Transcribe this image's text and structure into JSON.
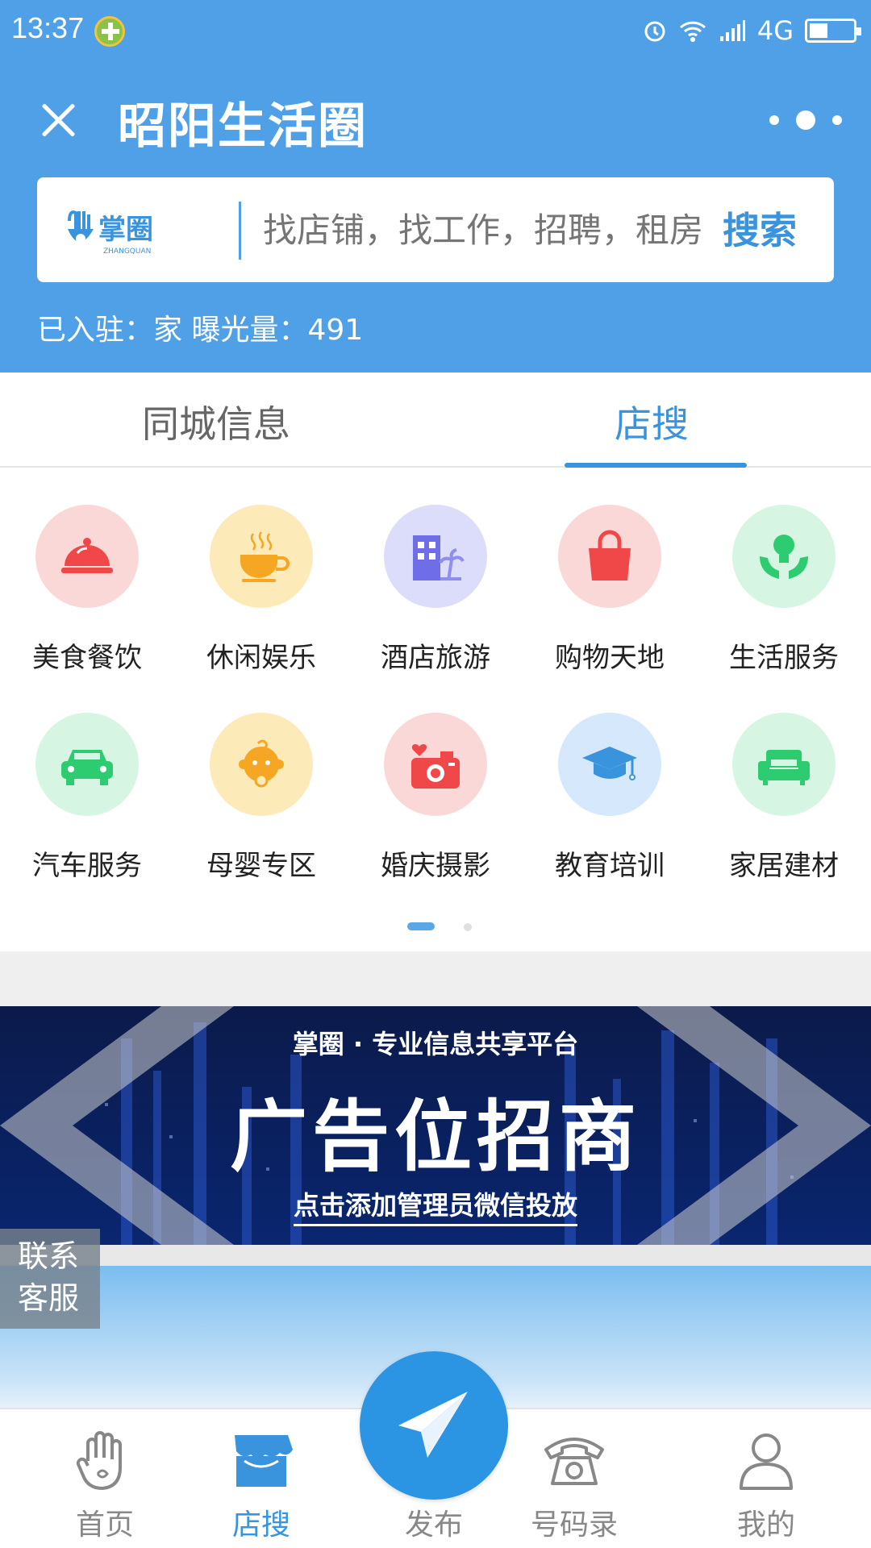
{
  "status_bar": {
    "time": "13:37",
    "network": "4G"
  },
  "header": {
    "title": "昭阳生活圈"
  },
  "search": {
    "brand": "掌圈",
    "brand_sub": "ZHANGQUAN",
    "placeholder": "找店铺，找工作，招聘，租房",
    "button_label": "搜索"
  },
  "stats": {
    "text": "已入驻：家 曝光量：491"
  },
  "tabs": [
    {
      "label": "同城信息",
      "active": false
    },
    {
      "label": "店搜",
      "active": true
    }
  ],
  "categories": [
    {
      "label": "美食餐饮",
      "icon": "food-cloche-icon",
      "bg": "#fbd8d8",
      "color": "#f04848"
    },
    {
      "label": "休闲娱乐",
      "icon": "coffee-cup-icon",
      "bg": "#fdeab9",
      "color": "#f5a623"
    },
    {
      "label": "酒店旅游",
      "icon": "hotel-building-icon",
      "bg": "#dcdcfb",
      "color": "#6f6ee8"
    },
    {
      "label": "购物天地",
      "icon": "shopping-bag-icon",
      "bg": "#fbd8d8",
      "color": "#f04848"
    },
    {
      "label": "生活服务",
      "icon": "lightbulb-hands-icon",
      "bg": "#d6f5e3",
      "color": "#2ecc71"
    },
    {
      "label": "汽车服务",
      "icon": "car-icon",
      "bg": "#d6f5e3",
      "color": "#2ecc71"
    },
    {
      "label": "母婴专区",
      "icon": "baby-icon",
      "bg": "#fdeab9",
      "color": "#f5a623"
    },
    {
      "label": "婚庆摄影",
      "icon": "camera-heart-icon",
      "bg": "#fbd8d8",
      "color": "#f04848"
    },
    {
      "label": "教育培训",
      "icon": "graduation-cap-icon",
      "bg": "#d6e8fb",
      "color": "#3a93dd"
    },
    {
      "label": "家居建材",
      "icon": "sofa-icon",
      "bg": "#d6f5e3",
      "color": "#2ecc71"
    }
  ],
  "banner": {
    "subtitle": "掌圈 · 专业信息共享平台",
    "title": "广告位招商",
    "cta": "点击添加管理员微信投放"
  },
  "contact": {
    "line1": "联系",
    "line2": "客服"
  },
  "bottom_nav": [
    {
      "label": "首页",
      "icon": "hand-home-icon",
      "active": false
    },
    {
      "label": "店搜",
      "icon": "store-icon",
      "active": true
    },
    {
      "label": "发布",
      "icon": "paper-plane-icon",
      "active": false
    },
    {
      "label": "号码录",
      "icon": "telephone-icon",
      "active": false
    },
    {
      "label": "我的",
      "icon": "user-icon",
      "active": false
    }
  ],
  "colors": {
    "primary": "#4fa0e6",
    "accent": "#3a93dd",
    "publish": "#2b95e3"
  }
}
